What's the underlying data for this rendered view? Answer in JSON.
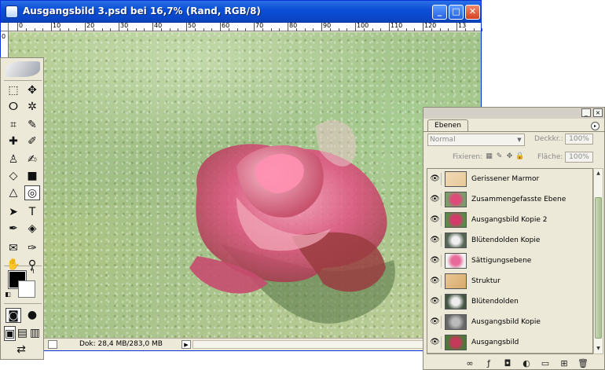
{
  "window": {
    "title": "Ausgangsbild 3.psd bei 16,7% (Rand, RGB/8)",
    "minimize": "_",
    "maximize": "□",
    "close": "✕"
  },
  "ruler": {
    "top_labels": [
      "0",
      "10",
      "20",
      "30",
      "40",
      "50",
      "60",
      "70",
      "80",
      "90",
      "100",
      "110",
      "120",
      "13"
    ],
    "left_label": "0"
  },
  "statusbar": {
    "doc": "Dok: 28,4 MB/283,0 MB",
    "arrow": "▶"
  },
  "toolbox": {
    "tools": [
      {
        "name": "marquee-tool",
        "glyph": "⬚"
      },
      {
        "name": "move-tool",
        "glyph": "✥"
      },
      {
        "name": "lasso-tool",
        "glyph": "ⵔ"
      },
      {
        "name": "magic-wand-tool",
        "glyph": "✲"
      },
      {
        "name": "crop-tool",
        "glyph": "⌗"
      },
      {
        "name": "slice-tool",
        "glyph": "✎"
      },
      {
        "name": "healing-brush-tool",
        "glyph": "✚"
      },
      {
        "name": "brush-tool",
        "glyph": "✐"
      },
      {
        "name": "clone-stamp-tool",
        "glyph": "♙"
      },
      {
        "name": "history-brush-tool",
        "glyph": "✍"
      },
      {
        "name": "eraser-tool",
        "glyph": "◇"
      },
      {
        "name": "gradient-tool",
        "glyph": "■"
      },
      {
        "name": "blur-tool",
        "glyph": "△"
      },
      {
        "name": "dodge-tool",
        "glyph": "◎"
      },
      {
        "name": "path-select-tool",
        "glyph": "➤"
      },
      {
        "name": "type-tool",
        "glyph": "T"
      },
      {
        "name": "pen-tool",
        "glyph": "✒"
      },
      {
        "name": "shape-tool",
        "glyph": "◈"
      },
      {
        "name": "notes-tool",
        "glyph": "✉"
      },
      {
        "name": "eyedropper-tool",
        "glyph": "✑"
      },
      {
        "name": "hand-tool",
        "glyph": "✋"
      },
      {
        "name": "zoom-tool",
        "glyph": "⚲"
      }
    ],
    "swap": "↰",
    "default_colors": "◧",
    "quickmask_standard": "◙",
    "quickmask_mode": "●",
    "screen_modes": [
      "▣",
      "▤",
      "▥"
    ],
    "jump_to": "⇄"
  },
  "colors": {
    "foreground": "#000000",
    "background": "#ffffff"
  },
  "layers_panel": {
    "tab": "Ebenen",
    "menu": "▸",
    "blend_mode": "Normal",
    "opacity_label": "Deckkr.:",
    "opacity_value": "100%",
    "lock_label": "Fixieren:",
    "fill_label": "Fläche:",
    "fill_value": "100%",
    "layers": [
      {
        "name": "Gerissener Marmor",
        "visible": "👁"
      },
      {
        "name": "Zusammengefasste Ebene",
        "visible": "👁"
      },
      {
        "name": "Ausgangsbild Kopie 2",
        "visible": "👁"
      },
      {
        "name": "Blütendolden Kopie",
        "visible": "👁"
      },
      {
        "name": "Sättigungsebene",
        "visible": "👁"
      },
      {
        "name": "Struktur",
        "visible": "👁"
      },
      {
        "name": "Blütendolden",
        "visible": "👁"
      },
      {
        "name": "Ausgangsbild Kopie",
        "visible": "👁"
      },
      {
        "name": "Ausgangsbild",
        "visible": "👁"
      }
    ],
    "footer_icons": [
      "∞",
      "ƒ",
      "◘",
      "◐",
      "▭",
      "⊞",
      "🗑"
    ]
  }
}
